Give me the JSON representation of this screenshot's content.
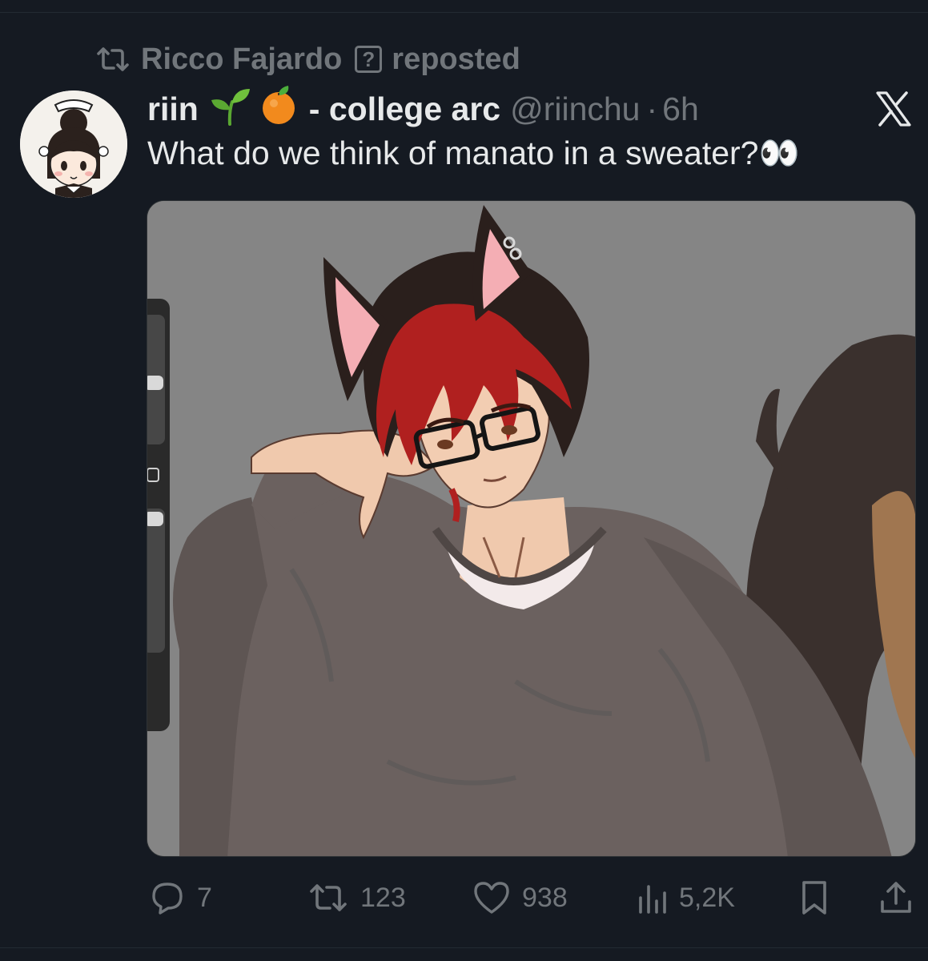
{
  "repost": {
    "user": "Ricco Fajardo",
    "badge": "?",
    "label": "reposted"
  },
  "tweet": {
    "display_name": "riin",
    "name_suffix": "- college arc",
    "handle": "@riinchu",
    "separator": "·",
    "time": "6h",
    "text": "What do we think of manato in a sweater?",
    "emoji_suffix": "👀"
  },
  "actions": {
    "replies": "7",
    "reposts": "123",
    "likes": "938",
    "views": "5,2K"
  },
  "icons": {
    "repost": "repost-icon",
    "reply": "reply-icon",
    "like": "heart-icon",
    "views": "views-icon",
    "bookmark": "bookmark-icon",
    "share": "share-icon",
    "platform": "x-logo-icon"
  },
  "colors": {
    "background": "#151a22",
    "text": "#e7e9ea",
    "muted": "#71767b"
  }
}
